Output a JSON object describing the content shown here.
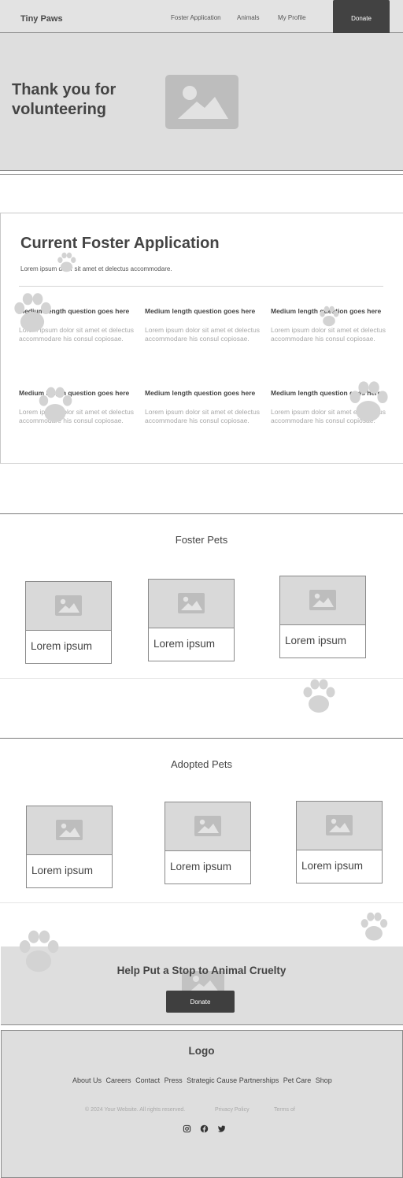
{
  "nav": {
    "brand": "Tiny Paws",
    "links": [
      "Foster Application",
      "Animals",
      "My Profile"
    ],
    "donate_label": "Donate"
  },
  "hero": {
    "title": "Thank you for volunteering",
    "image_icon": "image-placeholder-icon"
  },
  "application": {
    "title": "Current Foster Application",
    "subtitle": "Lorem ipsum dolor sit amet et delectus accommodare.",
    "questions": [
      {
        "title": "Medium length question goes here",
        "body": "Lorem ipsum dolor sit amet et delectus accommodare his consul copiosae."
      },
      {
        "title": "Medium length question goes here",
        "body": "Lorem ipsum dolor sit amet et delectus accommodare his consul copiosae."
      },
      {
        "title": "Medium length question goes here",
        "body": "Lorem ipsum dolor sit amet et delectus accommodare his consul copiosae."
      },
      {
        "title": "Medium length question goes here",
        "body": "Lorem ipsum dolor sit amet et delectus accommodare his consul copiosae."
      },
      {
        "title": "Medium length question goes here",
        "body": "Lorem ipsum dolor sit amet et delectus accommodare his consul copiosae."
      },
      {
        "title": "Medium length question goes here",
        "body": "Lorem ipsum dolor sit amet et delectus accommodare his consul copiosae."
      }
    ]
  },
  "foster_pets": {
    "title": "Foster Pets",
    "cards": [
      {
        "label": "Lorem ipsum"
      },
      {
        "label": "Lorem ipsum"
      },
      {
        "label": "Lorem ipsum"
      }
    ]
  },
  "adopted_pets": {
    "title": "Adopted Pets",
    "cards": [
      {
        "label": "Lorem ipsum"
      },
      {
        "label": "Lorem ipsum"
      },
      {
        "label": "Lorem ipsum"
      }
    ]
  },
  "cta": {
    "title": "Help Put a Stop to Animal Cruelty",
    "button_label": "Donate"
  },
  "footer": {
    "logo": "Logo",
    "links": [
      "About Us",
      "Careers",
      "Contact",
      "Press",
      "Strategic Cause Partnerships",
      "Pet Care",
      "Shop"
    ],
    "copyright": "© 2024 Your Website. All rights reserved.",
    "privacy": "Privacy Policy",
    "terms": "Terms of",
    "social_icons": [
      "instagram-icon",
      "facebook-icon",
      "twitter-icon"
    ]
  },
  "colors": {
    "header_bg": "#e3e3e3",
    "button_dark": "#424242",
    "placeholder_gray": "#dedede",
    "paw_gray": "#d3d3d3"
  }
}
